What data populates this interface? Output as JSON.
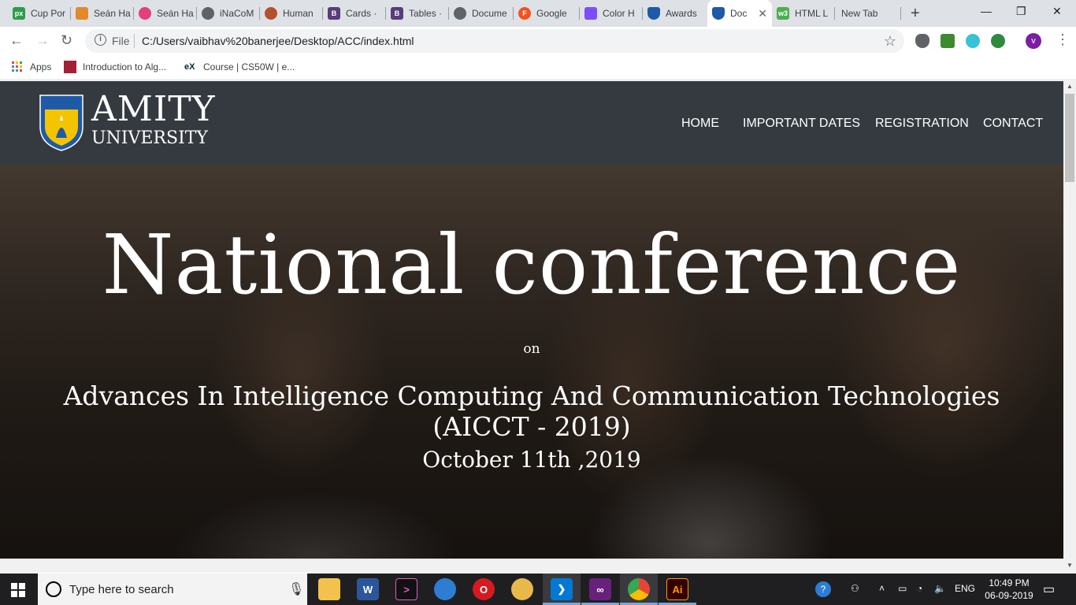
{
  "browser": {
    "tabs": [
      {
        "title": "Cup Por",
        "favicon_color": "#2e9c4a",
        "favicon_glyph": "px"
      },
      {
        "title": "Seán Ha",
        "favicon_color": "#e08a2c",
        "favicon_glyph": ""
      },
      {
        "title": "Seán Ha",
        "favicon_color": "#e63e7a",
        "favicon_glyph": ""
      },
      {
        "title": "iNaCoM",
        "favicon_color": "#5f6368",
        "favicon_glyph": ""
      },
      {
        "title": "Human",
        "favicon_color": "#b4512d",
        "favicon_glyph": ""
      },
      {
        "title": "Cards ·",
        "favicon_color": "#563d7c",
        "favicon_glyph": "B"
      },
      {
        "title": "Tables ·",
        "favicon_color": "#563d7c",
        "favicon_glyph": "B"
      },
      {
        "title": "Docume",
        "favicon_color": "#5f6368",
        "favicon_glyph": ""
      },
      {
        "title": "Google",
        "favicon_color": "#f4511e",
        "favicon_glyph": "F"
      },
      {
        "title": "Color H",
        "favicon_color": "#7c4dff",
        "favicon_glyph": ""
      },
      {
        "title": "Awards",
        "favicon_color": "#1e5aa8",
        "favicon_glyph": ""
      },
      {
        "title": "Doc",
        "favicon_color": "#1e5aa8",
        "favicon_glyph": "",
        "active": true
      },
      {
        "title": "HTML L",
        "favicon_color": "#4caf50",
        "favicon_glyph": "w3"
      },
      {
        "title": "New Tab",
        "favicon_color": "",
        "favicon_glyph": ""
      }
    ],
    "file_label": "File",
    "url": "C:/Users/vaibhav%20banerjee/Desktop/ACC/index.html",
    "avatar_letter": "v",
    "bookmarks": [
      {
        "label": "Apps"
      },
      {
        "label": "Introduction to Alg..."
      },
      {
        "label": "Course | CS50W | e..."
      }
    ]
  },
  "page": {
    "logo_title": "AMITY",
    "logo_subtitle": "UNIVERSITY",
    "nav": [
      "HOME",
      "IMPORTANT DATES",
      "REGISTRATION",
      "CONTACT"
    ],
    "hero_title": "National conference",
    "hero_on": "on",
    "hero_subtitle": "Advances In Intelligence Computing And Communication Technologies (AICCT - 2019)",
    "hero_date": "October 11th ,2019"
  },
  "taskbar": {
    "search_placeholder": "Type here to search",
    "language": "ENG",
    "time": "10:49 PM",
    "date": "06-09-2019"
  },
  "colors": {
    "navbar": "#343a40",
    "tabstrip": "#dee1e6",
    "taskbar": "#1f1f22",
    "logo_blue": "#1e5aa8",
    "logo_yellow": "#f5c400"
  }
}
